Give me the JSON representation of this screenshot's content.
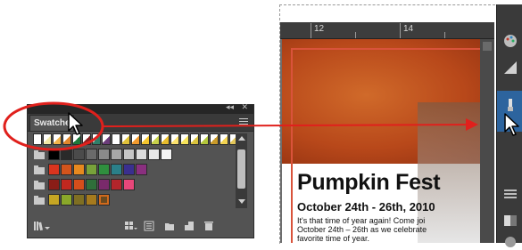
{
  "swatches_panel": {
    "tab_label": "Swatches",
    "collapse_control": "◂◂",
    "close_control": "✕",
    "swatch_rows": [
      [
        "#ffffff",
        "#f2e9a7",
        "#f2b54a",
        "#e0872c",
        "#1d7a3b",
        "#8e1f1f",
        "#2f7f6a",
        "#6b3c7a",
        "#ffffff",
        "#e0c23a",
        "#f19a2e",
        "#f3c42d",
        "#c8d04a",
        "#e7bc2c",
        "#fbe16d",
        "#f7e35a",
        "#d9c23c",
        "#b3c63b",
        "#c99a2a",
        "#f3d351",
        "#e4c75a"
      ],
      [
        "#000000",
        "#2a2a2a",
        "#4b4b4b",
        "#6a6a6a",
        "#8a8a8a",
        "#a8a8a8",
        "#c6c6c6",
        "#dcdcdc",
        "#e8e8e8",
        "#f3f3f3"
      ],
      [
        "#d9341e",
        "#d3541c",
        "#e7891f",
        "#78a23a",
        "#2f8f3e",
        "#2a7f89",
        "#3a2f8f",
        "#8a2f7f"
      ],
      [
        "#8a1d17",
        "#c0281f",
        "#d54e1b",
        "#2f6f3a",
        "#7a2a6b",
        "#b3252b",
        "#e8477a"
      ],
      [
        "#c6a623",
        "#8aa82a",
        "#7f6f23",
        "#a67a1d",
        "#6a4a1f"
      ]
    ],
    "selected_swatch": "#6a4a1f"
  },
  "document": {
    "ruler_numbers": [
      "12",
      "14"
    ],
    "title": "Pumpkin Fest",
    "subtitle": "October 24th - 26th, 2010",
    "body_lines": [
      "It's that time of year again! Come joi",
      "October 24th – 26th as we celebrate",
      "favorite time of year."
    ]
  },
  "annotation": {
    "circle_color": "#e0201c",
    "arrow_color": "#e0201c"
  }
}
